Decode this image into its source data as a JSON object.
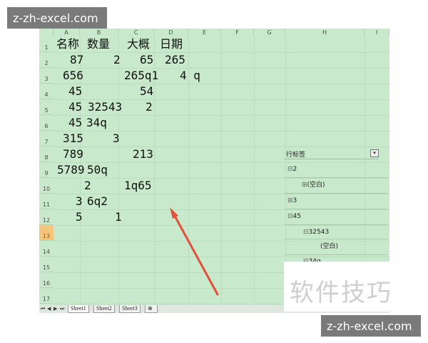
{
  "watermarks": {
    "top": "z-zh-excel.com",
    "bottom": "z-zh-excel.com",
    "brand": "软件技巧"
  },
  "columns": [
    "A",
    "B",
    "C",
    "D",
    "E",
    "F",
    "G",
    "H",
    "I"
  ],
  "rows": [
    "1",
    "2",
    "3",
    "4",
    "5",
    "6",
    "7",
    "8",
    "9",
    "10",
    "11",
    "12",
    "13",
    "14",
    "15",
    "16",
    "17"
  ],
  "selected_row": "13",
  "header_row": {
    "a": "名称",
    "b": "数量",
    "c": "大概",
    "d": "日期"
  },
  "cells": [
    {
      "a": "87",
      "b": "2",
      "c": "65",
      "d": "265"
    },
    {
      "a": "656",
      "b": "",
      "c": "265q1",
      "d": "4 q"
    },
    {
      "a": "45",
      "b": "",
      "c": "54",
      "d": ""
    },
    {
      "a": "45",
      "b": "32543",
      "c": "2",
      "d": ""
    },
    {
      "a": "45",
      "b": "34q",
      "c": "",
      "d": ""
    },
    {
      "a": "315",
      "b": "3",
      "c": "",
      "d": ""
    },
    {
      "a": "789",
      "b": "",
      "c": "213",
      "d": ""
    },
    {
      "a": "5789",
      "b": "50q",
      "c": "",
      "d": ""
    },
    {
      "a": "2",
      "b": "",
      "c": "1q65",
      "d": ""
    },
    {
      "a": "3",
      "b": "6q2",
      "c": "",
      "d": ""
    },
    {
      "a": "5",
      "b": "1",
      "c": "",
      "d": ""
    }
  ],
  "pivot": {
    "header": "行标签",
    "items": [
      {
        "toggle": "⊟",
        "label": "2"
      },
      {
        "toggle": "⊞",
        "label": "(空白)"
      },
      {
        "toggle": "⊞",
        "label": "3"
      },
      {
        "toggle": "⊟",
        "label": "45"
      },
      {
        "toggle": "⊟",
        "label": "32543"
      },
      {
        "toggle": "",
        "label": "(空白)"
      },
      {
        "toggle": "⊟",
        "label": "34q"
      }
    ]
  },
  "sheet_tabs": [
    "Sheet1",
    "Sheet2",
    "Sheet3"
  ],
  "colors": {
    "sheet_bg": "#c8e9cb",
    "arrow": "#e0503a",
    "selected_row": "#f5c57c"
  }
}
